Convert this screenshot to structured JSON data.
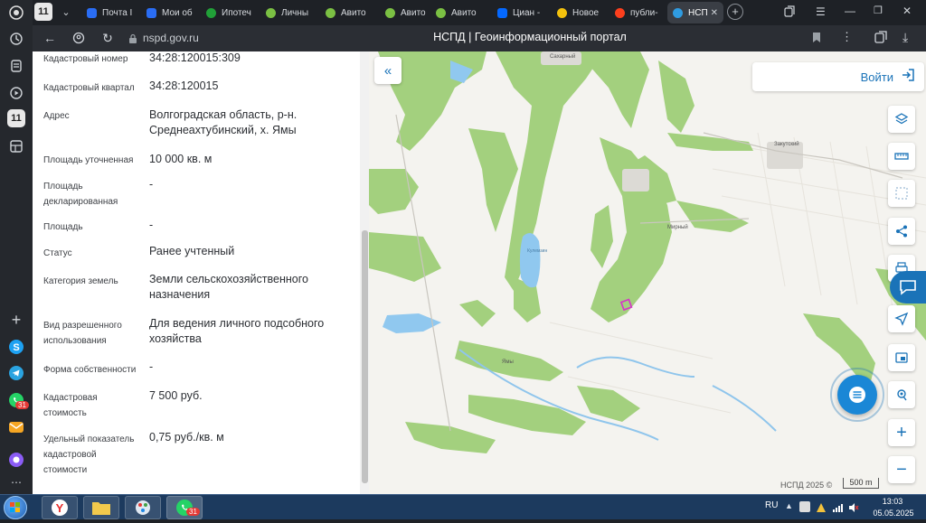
{
  "browser": {
    "workspace_badge": "11",
    "tabs": [
      {
        "label": "Почта I",
        "icon": "mail-icon",
        "color": "#2a6df4"
      },
      {
        "label": "Мои об",
        "icon": "mail-icon",
        "color": "#2a6df4"
      },
      {
        "label": "Ипотеч",
        "icon": "bank-icon",
        "color": "#21a038"
      },
      {
        "label": "Личны",
        "icon": "avito-icon",
        "color": "#7bc043"
      },
      {
        "label": "Авито",
        "icon": "avito-icon",
        "color": "#7bc043"
      },
      {
        "label": "Авито",
        "icon": "avito-icon",
        "color": "#7bc043"
      },
      {
        "label": "Авито",
        "icon": "avito-icon",
        "color": "#7bc043"
      },
      {
        "label": "Циан -",
        "icon": "cian-icon",
        "color": "#0468ff"
      },
      {
        "label": "Новое",
        "icon": "star-icon",
        "color": "#f4c20d"
      },
      {
        "label": "публи-",
        "icon": "yandex-icon",
        "color": "#fc3f1d"
      },
      {
        "label": "НСП",
        "icon": "nspd-icon",
        "color": "#2f9be0",
        "active": true
      }
    ],
    "url": "nspd.gov.ru",
    "page_title": "НСПД | Геоинформационный портал"
  },
  "panel": {
    "rows": [
      {
        "label": "Кадастровый номер",
        "value": "34:28:120015:309"
      },
      {
        "label": "Кадастровый квартал",
        "value": "34:28:120015"
      },
      {
        "label": "Адрес",
        "value": "Волгоградская область, р-н. Среднеахтубинский, х. Ямы"
      },
      {
        "label": "Площадь уточненная",
        "value": "10 000 кв. м"
      },
      {
        "label": "Площадь декларированная",
        "value": "-"
      },
      {
        "label": "Площадь",
        "value": "-"
      },
      {
        "label": "Статус",
        "value": "Ранее учтенный"
      },
      {
        "label": "Категория земель",
        "value": "Земли сельскохозяйственного назначения"
      },
      {
        "label": "Вид разрешенного использования",
        "value": "Для ведения личного подсобного хозяйства"
      },
      {
        "label": "Форма собственности",
        "value": "-"
      },
      {
        "label": "Кадастровая стоимость",
        "value": "7 500 руб."
      },
      {
        "label": "Удельный показатель кадастровой стоимости",
        "value": "0,75 руб./кв. м"
      }
    ]
  },
  "map": {
    "login_label": "Войти",
    "place_labels": [
      "Сахарный",
      "Закутский",
      "Ямы",
      "Мирный",
      "Кулемзин"
    ],
    "copyright": "НСПД 2025 ©",
    "scale": "500 m",
    "zoom_in": "+",
    "zoom_out": "−"
  },
  "taskbar": {
    "lang": "RU",
    "time": "13:03",
    "date": "05.05.2025",
    "whatsapp_badge": "31"
  },
  "colors": {
    "forest": "#9fcf7a",
    "water": "#8ec7ee",
    "accent": "#1a73b8",
    "parcel": "#d633c8"
  }
}
